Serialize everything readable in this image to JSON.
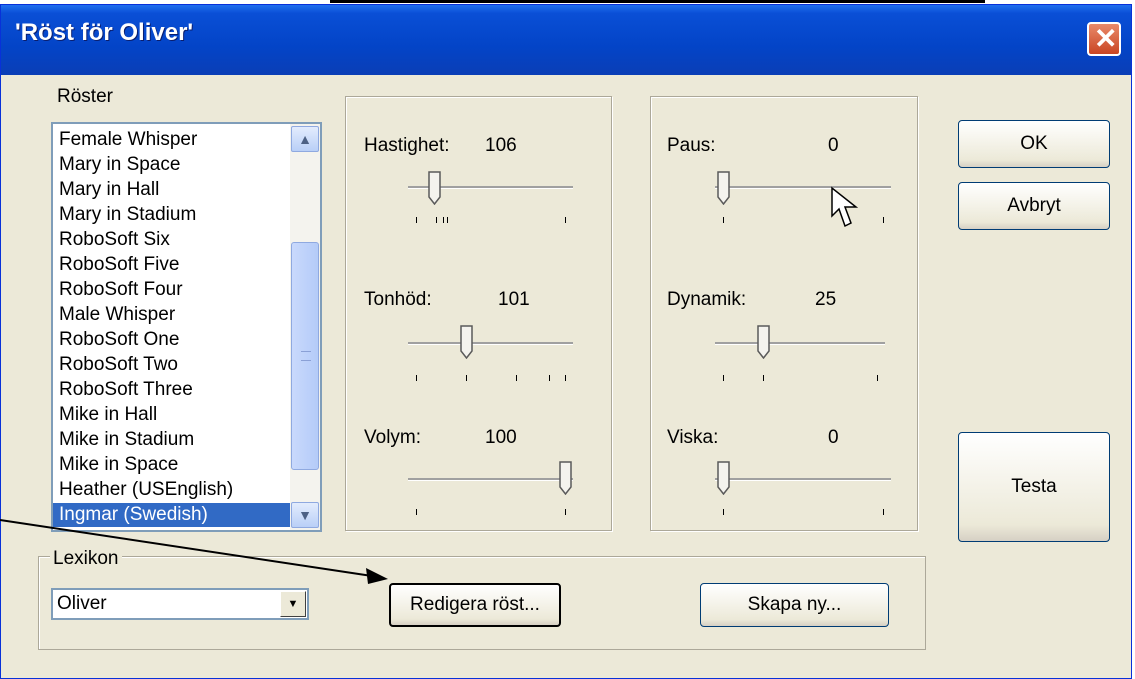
{
  "window": {
    "title": "'Röst för Oliver'"
  },
  "voices": {
    "label": "Röster",
    "items": [
      "Female Whisper",
      "Mary in Space",
      "Mary in Hall",
      "Mary in Stadium",
      "RoboSoft Six",
      "RoboSoft Five",
      "RoboSoft Four",
      "Male Whisper",
      "RoboSoft One",
      "RoboSoft Two",
      "RoboSoft Three",
      "Mike in Hall",
      "Mike in Stadium",
      "Mike in Space",
      "Heather (USEnglish)",
      "Ingmar (Swedish)"
    ],
    "selected": "Ingmar (Swedish)"
  },
  "sliders_left": {
    "speed": {
      "label": "Hastighet:",
      "value": "106"
    },
    "pitch": {
      "label": "Tonhöd:",
      "value": "101"
    },
    "volume": {
      "label": "Volym:",
      "value": "100"
    }
  },
  "sliders_right": {
    "pause": {
      "label": "Paus:",
      "value": "0"
    },
    "dynamics": {
      "label": "Dynamik:",
      "value": "25"
    },
    "whisper": {
      "label": "Viska:",
      "value": "0"
    }
  },
  "buttons": {
    "ok": "OK",
    "cancel": "Avbryt",
    "test": "Testa",
    "edit_voice": "Redigera röst...",
    "create_new": "Skapa ny..."
  },
  "lexicon": {
    "label": "Lexikon",
    "value": "Oliver"
  },
  "icons": {
    "close": "close-icon",
    "cursor": "mouse-pointer-icon",
    "scroll_up": "chevron-up-icon",
    "scroll_down": "chevron-down-icon",
    "dropdown": "chevron-down-icon"
  }
}
